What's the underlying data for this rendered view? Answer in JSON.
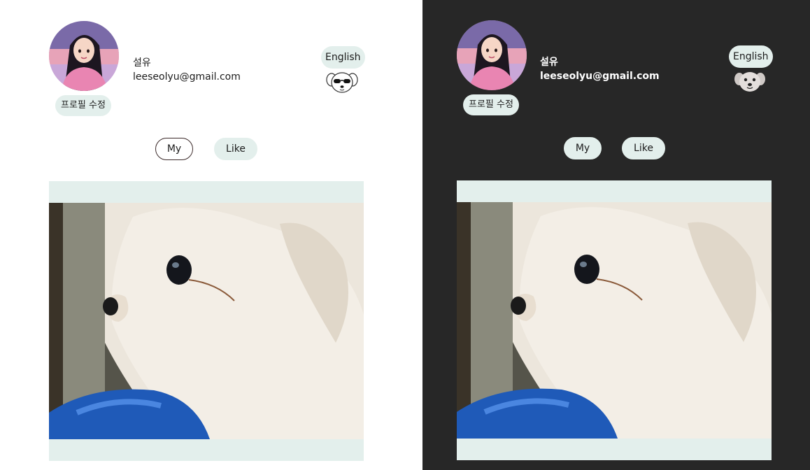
{
  "light": {
    "user": {
      "name": "설유",
      "email": "leeseolyu@gmail.com"
    },
    "edit_profile_label": "프로필 수정",
    "language_label": "English",
    "tabs": [
      {
        "label": "My",
        "selected": true
      },
      {
        "label": "Like",
        "selected": false
      }
    ]
  },
  "dark": {
    "user": {
      "name": "설유",
      "email": "leeseolyu@gmail.com"
    },
    "edit_profile_label": "프로필 수정",
    "language_label": "English",
    "tabs": [
      {
        "label": "My",
        "selected": false
      },
      {
        "label": "Like",
        "selected": false
      }
    ]
  },
  "icons": {
    "theme_light": "dog-sunglasses-icon",
    "theme_dark": "dog-face-icon"
  },
  "colors": {
    "accent": "#e3efec",
    "dark_bg": "#272727",
    "light_bg": "#ffffff",
    "selected_border": "#3b2a2a"
  }
}
